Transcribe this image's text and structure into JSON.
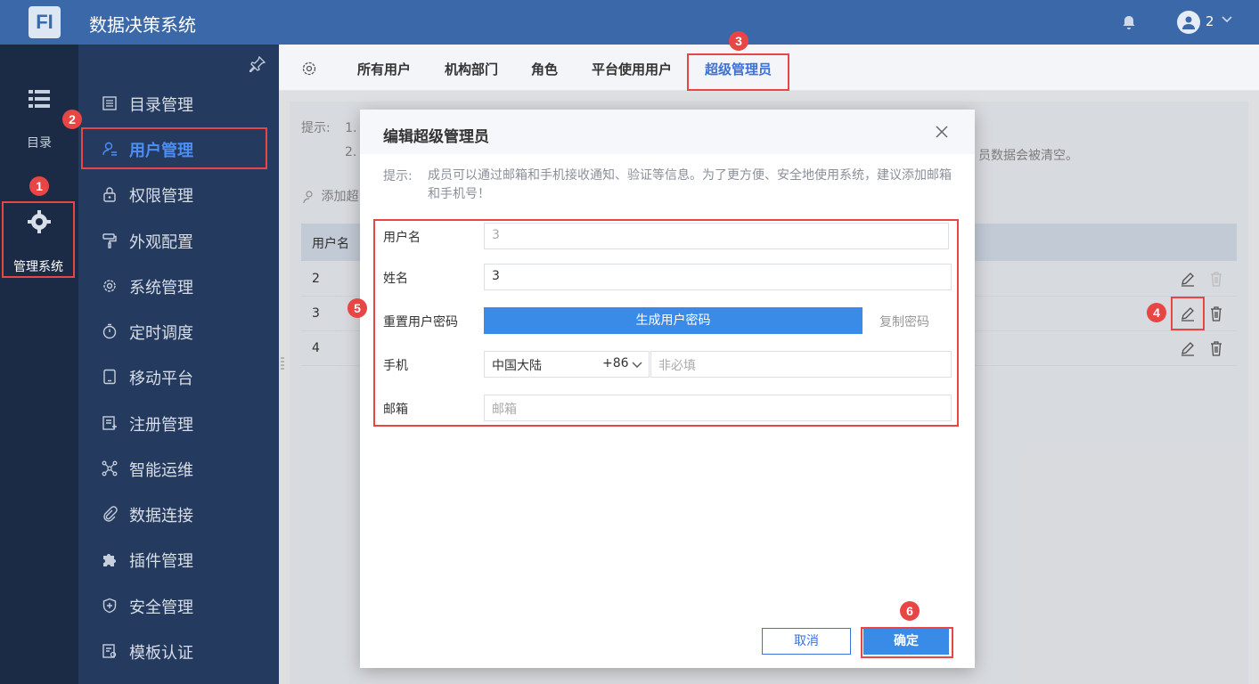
{
  "app": {
    "logo_letter": "FI",
    "title": "数据决策系统",
    "user": "2"
  },
  "rail": {
    "catalog_label": "目录",
    "system_label": "管理系统"
  },
  "sidebar": {
    "items": [
      {
        "label": "目录管理",
        "icon": "list-icon"
      },
      {
        "label": "用户管理",
        "icon": "user-icon",
        "active": true
      },
      {
        "label": "权限管理",
        "icon": "lock-icon"
      },
      {
        "label": "外观配置",
        "icon": "paint-roller-icon"
      },
      {
        "label": "系统管理",
        "icon": "gear-icon"
      },
      {
        "label": "定时调度",
        "icon": "timer-icon"
      },
      {
        "label": "移动平台",
        "icon": "tablet-icon"
      },
      {
        "label": "注册管理",
        "icon": "register-icon"
      },
      {
        "label": "智能运维",
        "icon": "network-icon"
      },
      {
        "label": "数据连接",
        "icon": "paperclip-icon"
      },
      {
        "label": "插件管理",
        "icon": "puzzle-icon"
      },
      {
        "label": "安全管理",
        "icon": "shield-icon"
      },
      {
        "label": "模板认证",
        "icon": "certificate-icon"
      }
    ]
  },
  "tabs": [
    {
      "label": "所有用户"
    },
    {
      "label": "机构部门"
    },
    {
      "label": "角色"
    },
    {
      "label": "平台使用用户"
    },
    {
      "label": "超级管理员",
      "active": true
    }
  ],
  "background": {
    "hint_label": "提示:",
    "hint_line1": "1.",
    "hint_line2": "2.",
    "hint_tail": "员数据会被清空。",
    "add_label": "添加超",
    "table_header": "用户名",
    "rows": [
      "2",
      "3",
      "4"
    ]
  },
  "dialog": {
    "title": "编辑超级管理员",
    "tip_label": "提示:",
    "tip_text": "成员可以通过邮箱和手机接收通知、验证等信息。为了更方便、安全地使用系统，建议添加邮箱和手机号！",
    "username_label": "用户名",
    "username_value": "3",
    "name_label": "姓名",
    "name_value": "3",
    "reset_pwd_label": "重置用户密码",
    "generate_btn": "生成用户密码",
    "copy_pwd": "复制密码",
    "phone_label": "手机",
    "country": "中国大陆",
    "country_code": "+86",
    "phone_placeholder": "非必填",
    "email_label": "邮箱",
    "email_placeholder": "邮箱",
    "cancel": "取消",
    "ok": "确定"
  },
  "markers": [
    "1",
    "2",
    "3",
    "4",
    "5",
    "6"
  ],
  "colors": {
    "topbar": "#3a68a8",
    "rail": "#1c2b45",
    "sidebar": "#243a5e",
    "accent": "#3a8ae8",
    "highlight": "#e84545"
  }
}
